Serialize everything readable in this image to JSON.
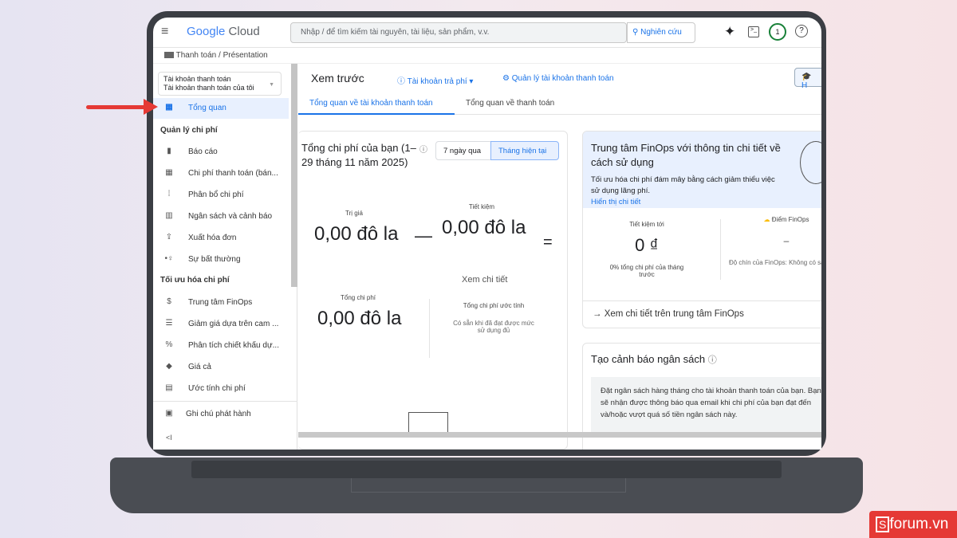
{
  "header": {
    "logo_google": "Google",
    "logo_cloud": "Cloud",
    "search_placeholder": "Nhập / để tìm kiếm tài nguyên, tài liệu, sản phẩm, v.v.",
    "search_button": "Nghiên cứu",
    "notification_count": "1"
  },
  "breadcrumb": {
    "root": "Thanh toán",
    "sep": "/",
    "current": "Présentation"
  },
  "sidebar": {
    "account_label": "Tài khoản thanh toán",
    "account_value": "Tài khoản thanh toán của tôi",
    "overview": "Tổng quan",
    "sections": [
      {
        "title": "Quản lý chi phí",
        "items": [
          "Báo cáo",
          "Chi phí thanh toán (bán...",
          "Phân bổ chi phí",
          "Ngân sách và cảnh báo",
          "Xuất hóa đơn",
          "Sự bất thường"
        ]
      },
      {
        "title": "Tối ưu hóa chi phí",
        "items": [
          "Trung tâm FinOps",
          "Giảm giá dựa trên cam ...",
          "Phân tích chiết khấu dự...",
          "Giá cả",
          "Ước tính chi phí"
        ]
      }
    ],
    "release_notes": "Ghi chú phát hành",
    "collapse": "<I"
  },
  "main": {
    "title": "Xem trước",
    "account_type": "Tài khoản trả phí",
    "manage": "Quản lý tài khoản thanh toán",
    "learn": "H",
    "tabs": [
      "Tổng quan về tài khoản thanh toán",
      "Tổng quan về thanh toán"
    ],
    "cost_card": {
      "title": "Tổng chi phí của bạn (1–29 tháng 11 năm 2025)",
      "range_options": [
        "7 ngày qua",
        "Tháng hiện tại"
      ],
      "selected": "Tháng hiện tại",
      "value_label": "Trị giá",
      "value": "0,00 đô la",
      "minus": "—",
      "savings_label": "Tiết kiệm",
      "savings": "0,00 đô la",
      "equals": "=",
      "view_details": "Xem chi tiết",
      "total_label": "Tổng chi phí",
      "total": "0,00 đô la",
      "forecast_label": "Tổng chi phí ước tính",
      "forecast_note": "Có sẵn khi đã đạt được mức sử dụng đủ"
    },
    "finops_card": {
      "title": "Trung tâm FinOps với thông tin chi tiết về cách sử dụng",
      "desc": "Tối ưu hóa chi phí đám mây bằng cách giảm thiểu việc sử dụng lãng phí.",
      "link": "Hiển thị chi tiết",
      "savings_label": "Tiết kiệm tới",
      "savings_value": "0 ₫",
      "savings_note": "0% tổng chi phí của tháng trước",
      "score_label": "Điểm FinOps",
      "score_value": "–",
      "maturity": "Độ chín của FinOps: Không có sẵn",
      "footer_link": "Xem chi tiết trên trung tâm FinOps"
    },
    "budget_card": {
      "title": "Tạo cảnh báo ngân sách",
      "desc": "Đặt ngân sách hàng tháng cho tài khoản thanh toán của bạn. Bạn sẽ nhận được thông báo qua email khi chi phí của bạn đạt đến và/hoặc vượt quá số tiền ngân sách này."
    }
  },
  "watermark": "forum.vn",
  "colors": {
    "accent": "#1a73e8",
    "selected_bg": "#e8f0fe",
    "arrow": "#e53935"
  }
}
